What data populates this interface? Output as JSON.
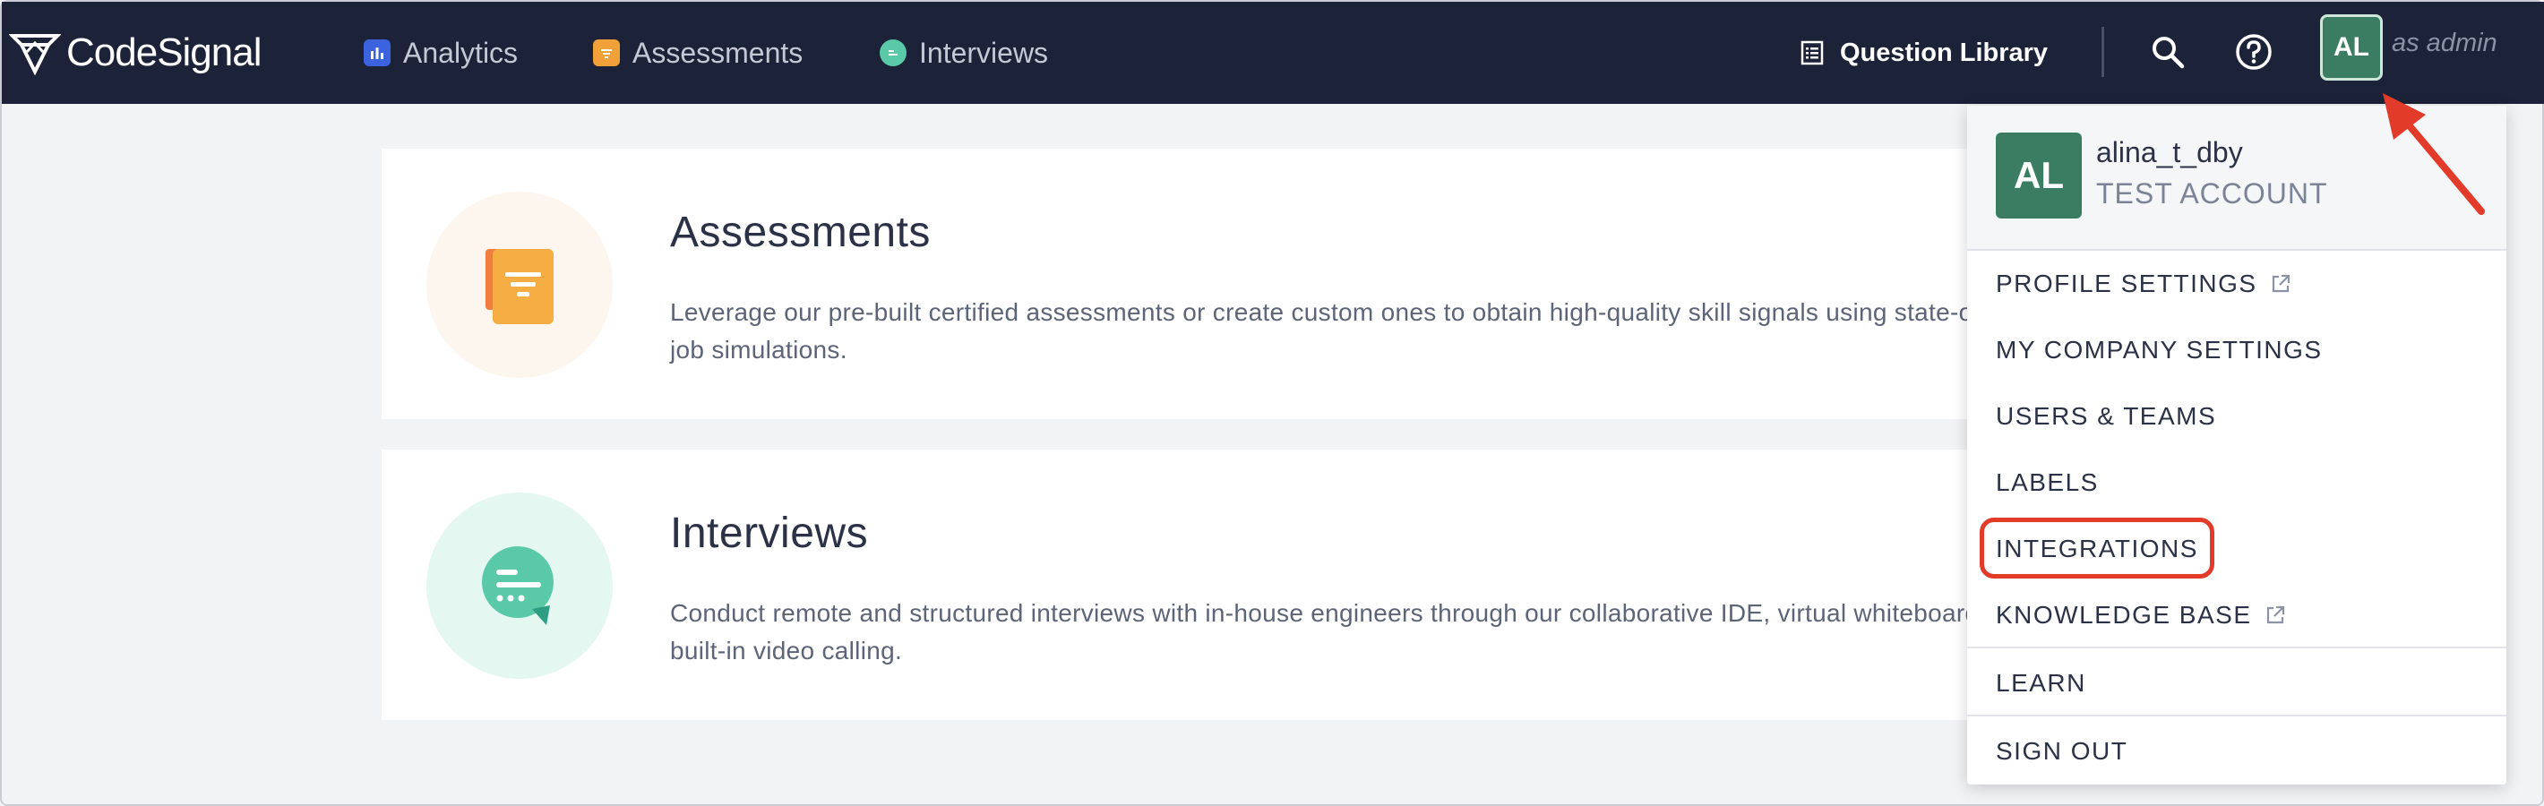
{
  "logo": {
    "text": "CodeSignal"
  },
  "nav": {
    "items": [
      {
        "label": "Analytics",
        "icon": "analytics-icon",
        "icon_color": "#3b63e0"
      },
      {
        "label": "Assessments",
        "icon": "assessments-icon",
        "icon_color": "#f0a13a"
      },
      {
        "label": "Interviews",
        "icon": "interviews-icon",
        "icon_color": "#5ac9a8"
      }
    ],
    "question_library": "Question Library",
    "avatar_initials": "AL",
    "role_text": "as admin"
  },
  "cards": [
    {
      "title": "Assessments",
      "description": "Leverage our pre-built certified assessments or create custom ones to obtain high-quality skill signals using state-of-the-art job simulations.",
      "icon": "assessment-doc-icon"
    },
    {
      "title": "Interviews",
      "description": "Conduct remote and structured interviews with in-house engineers through our collaborative IDE, virtual whiteboard, and built-in video calling.",
      "icon": "chat-bubble-icon"
    }
  ],
  "dropdown": {
    "avatar_initials": "AL",
    "username": "alina_t_dby",
    "account_type": "TEST ACCOUNT",
    "items": [
      {
        "label": "PROFILE SETTINGS",
        "external": true
      },
      {
        "label": "MY COMPANY SETTINGS",
        "external": false
      },
      {
        "label": "USERS & TEAMS",
        "external": false
      },
      {
        "label": "LABELS",
        "external": false
      },
      {
        "label": "INTEGRATIONS",
        "external": false,
        "highlighted": true
      },
      {
        "label": "KNOWLEDGE BASE",
        "external": true
      },
      {
        "label": "LEARN",
        "external": false
      },
      {
        "label": "SIGN OUT",
        "external": false
      }
    ]
  },
  "colors": {
    "nav_bg": "#1c2237",
    "avatar_green": "#3a7d62",
    "highlight_red": "#e23b2a"
  }
}
